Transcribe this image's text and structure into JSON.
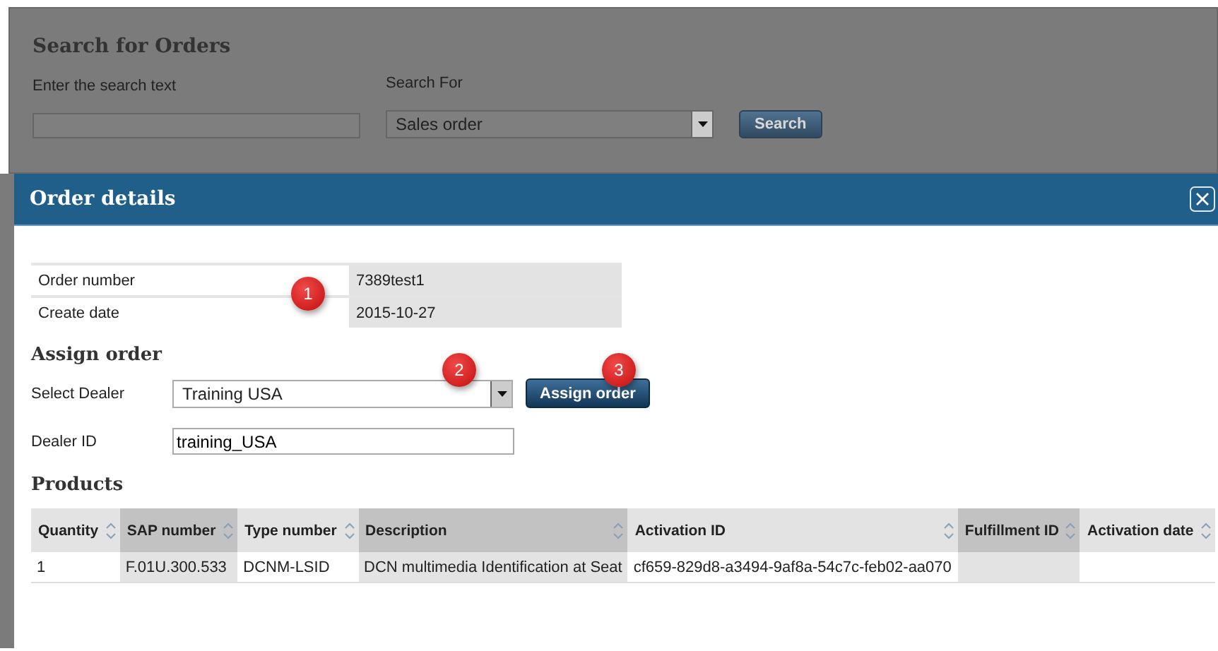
{
  "search_panel": {
    "title": "Search for Orders",
    "search_text_label": "Enter the search text",
    "search_for_label": "Search For",
    "search_for_value": "Sales order",
    "search_button": "Search"
  },
  "dialog": {
    "title": "Order details",
    "info_rows": [
      {
        "label": "Order number",
        "value": "7389test1"
      },
      {
        "label": "Create date",
        "value": "2015-10-27"
      }
    ],
    "assign_heading": "Assign order",
    "dealer_label": "Select Dealer",
    "dealer_value": "Training USA",
    "assign_button": "Assign order",
    "dealer_id_label": "Dealer ID",
    "dealer_id_value": "training_USA",
    "products_heading": "Products",
    "columns": [
      "Quantity",
      "SAP number",
      "Type number",
      "Description",
      "Activation ID",
      "Fulfillment ID",
      "Activation date"
    ],
    "rows": [
      [
        "1",
        "F.01U.300.533",
        "DCNM-LSID",
        "DCN multimedia Identification at Seat",
        "cf659-829d8-a3494-9af8a-54c7c-feb02-aa070",
        "",
        ""
      ]
    ]
  },
  "callouts": [
    "1",
    "2",
    "3"
  ]
}
